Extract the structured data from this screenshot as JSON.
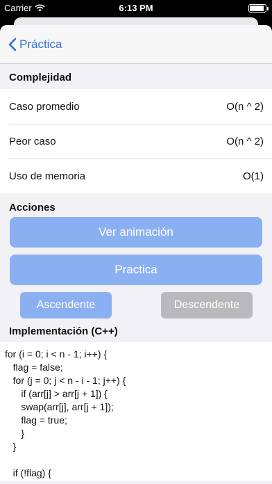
{
  "status": {
    "carrier": "Carrier",
    "time": "6:13 PM"
  },
  "nav": {
    "back_label": "Práctica"
  },
  "complejidad": {
    "header": "Complejidad",
    "rows": [
      {
        "label": "Caso promedio",
        "value": "O(n ^ 2)"
      },
      {
        "label": "Peor caso",
        "value": "O(n ^ 2)"
      },
      {
        "label": "Uso de memoria",
        "value": "O(1)"
      }
    ]
  },
  "acciones": {
    "header": "Acciones",
    "ver_animacion": "Ver animación",
    "practica": "Practica",
    "ascendente": "Ascendente",
    "descendente": "Descendente"
  },
  "implementacion": {
    "header": "Implementación (C++)",
    "code": "for (i = 0; i < n - 1; i++) {\n   flag = false;\n   for (j = 0; j < n - i - 1; j++) {\n      if (arr[j] > arr[j + 1]) {\n      swap(arr[j], arr[j + 1]);\n      flag = true;\n      }\n   }\n\n   if (!flag) {"
  },
  "colors": {
    "accent": "#2f6fdb",
    "button": "#8bb0f2",
    "button_disabled": "#b9b9bd"
  }
}
